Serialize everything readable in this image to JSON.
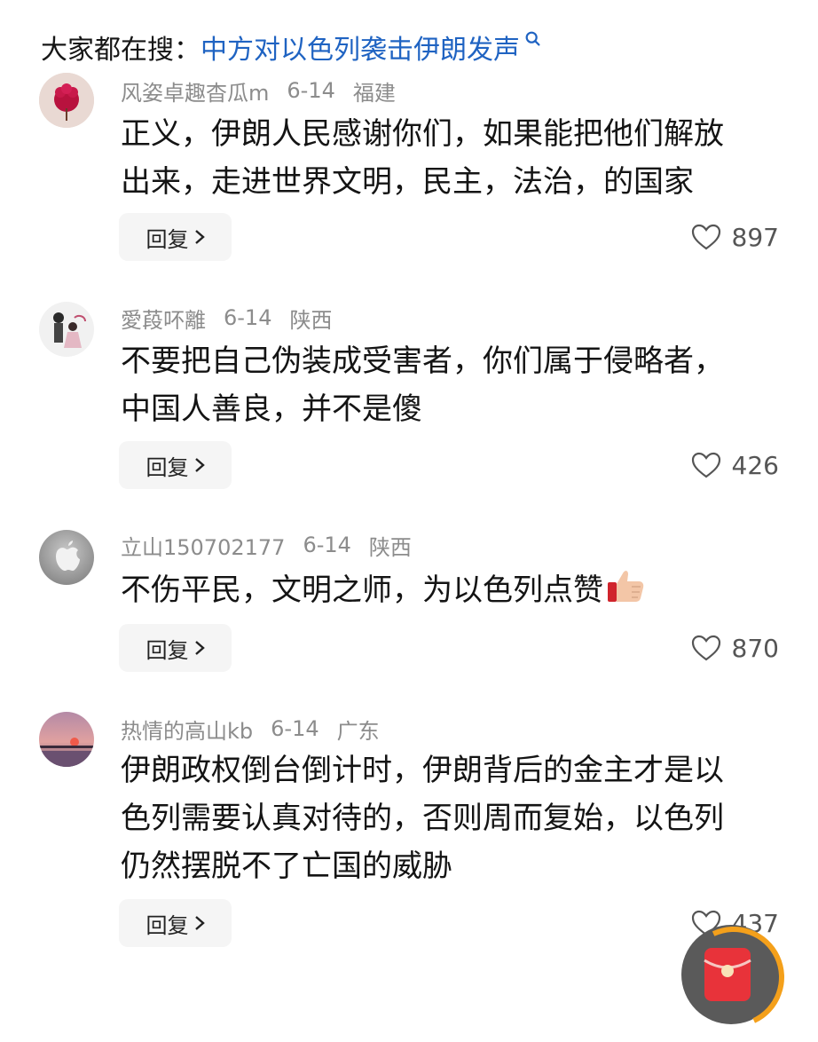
{
  "search": {
    "prefix": "大家都在搜：",
    "query": "中方对以色列袭击伊朗发声"
  },
  "comments": [
    {
      "username": "风姿卓趣杳瓜m",
      "date": "6-14",
      "location": "福建",
      "text_lines": [
        "正义，伊朗人民感谢你们，如果能把他们解放",
        "出来，走进世界文明，民主，法治，的国家"
      ],
      "reply_label": "回复",
      "likes": "897"
    },
    {
      "username": "愛葮吥離",
      "date": "6-14",
      "location": "陕西",
      "text_lines": [
        "不要把自己伪装成受害者，你们属于侵略者，",
        "中国人善良，并不是傻"
      ],
      "reply_label": "回复",
      "likes": "426"
    },
    {
      "username": "立山150702177",
      "date": "6-14",
      "location": "陕西",
      "text_lines": [
        "不伤平民，文明之师，为以色列点赞"
      ],
      "reply_label": "回复",
      "likes": "870"
    },
    {
      "username": "热情的高山kb",
      "date": "6-14",
      "location": "广东",
      "text_lines": [
        "伊朗政权倒台倒计时，伊朗背后的金主才是以",
        "色列需要认真对待的，否则周而复始，以色列",
        "仍然摆脱不了亡国的威胁"
      ],
      "reply_label": "回复",
      "likes": "437"
    }
  ],
  "colors": {
    "accent": "#1f63c2",
    "meta": "#8c8c8c",
    "reply_bg": "#f5f5f5"
  }
}
